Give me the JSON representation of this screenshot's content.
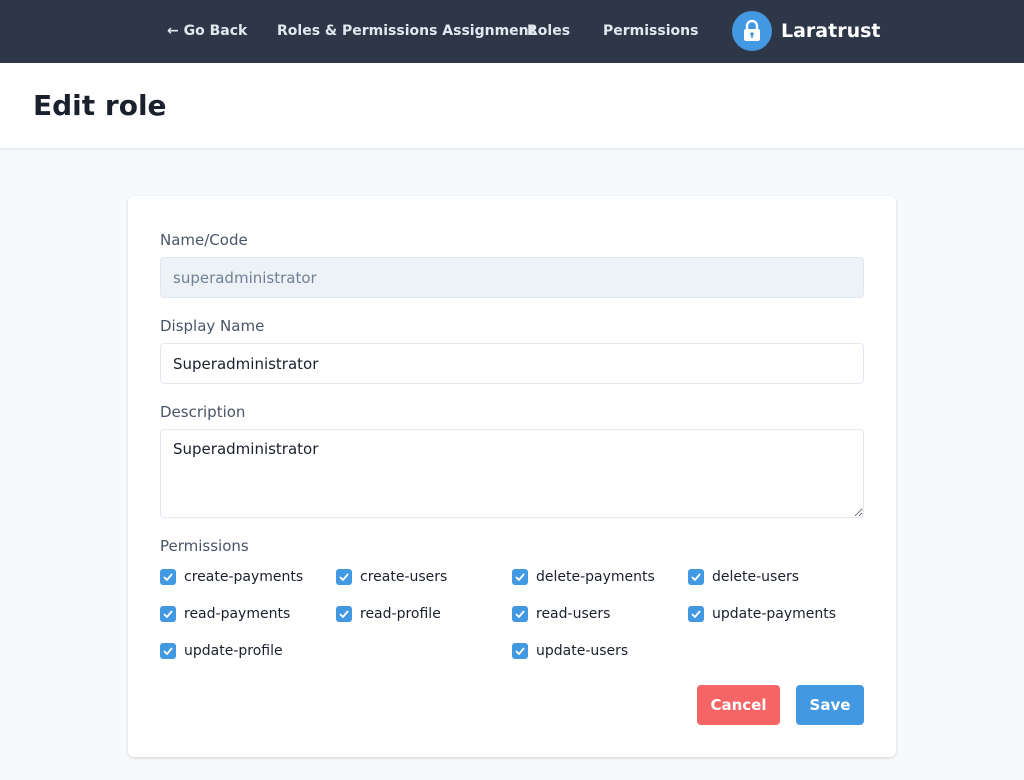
{
  "nav": {
    "back_label": "← Go Back",
    "assignment_label": "Roles & Permissions Assignment",
    "roles_label": "Roles",
    "permissions_label": "Permissions",
    "brand_name": "Laratrust",
    "brand_icon": "lock-icon"
  },
  "header": {
    "title": "Edit role"
  },
  "form": {
    "name_label": "Name/Code",
    "name_value": "superadministrator",
    "display_label": "Display Name",
    "display_value": "Superadministrator",
    "description_label": "Description",
    "description_value": "Superadministrator",
    "permissions_label": "Permissions",
    "permissions": [
      {
        "label": "create-payments",
        "checked": true
      },
      {
        "label": "create-users",
        "checked": true
      },
      {
        "label": "delete-payments",
        "checked": true
      },
      {
        "label": "delete-users",
        "checked": true
      },
      {
        "label": "read-payments",
        "checked": true
      },
      {
        "label": "read-profile",
        "checked": true
      },
      {
        "label": "read-users",
        "checked": true
      },
      {
        "label": "update-payments",
        "checked": true
      },
      {
        "label": "update-profile",
        "checked": true
      },
      {
        "label": "update-users",
        "checked": true
      }
    ],
    "cancel_label": "Cancel",
    "save_label": "Save"
  },
  "colors": {
    "nav_bg": "#2d3748",
    "accent": "#4299e1",
    "danger": "#f56565"
  }
}
